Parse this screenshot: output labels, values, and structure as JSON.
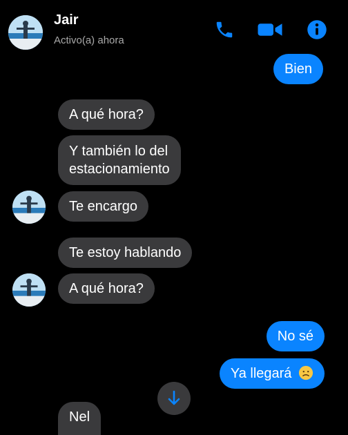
{
  "header": {
    "name": "Jair",
    "status": "Activo(a) ahora",
    "icons": {
      "call": "phone-icon",
      "video": "video-camera-icon",
      "info": "info-icon"
    }
  },
  "colors": {
    "accent": "#0a84ff",
    "incoming_bubble": "#3a3a3c",
    "background": "#000000"
  },
  "messages": {
    "m1": "Bien",
    "m2": "A qué hora?",
    "m3_line1": "Y también lo del",
    "m3_line2": "estacionamiento",
    "m4": "Te encargo",
    "m5": "Te estoy hablando",
    "m6": "A qué hora?",
    "m7": "No sé",
    "m8": "Ya llegará",
    "m9": "Nel"
  },
  "controls": {
    "scroll_down": "arrow-down-icon"
  }
}
